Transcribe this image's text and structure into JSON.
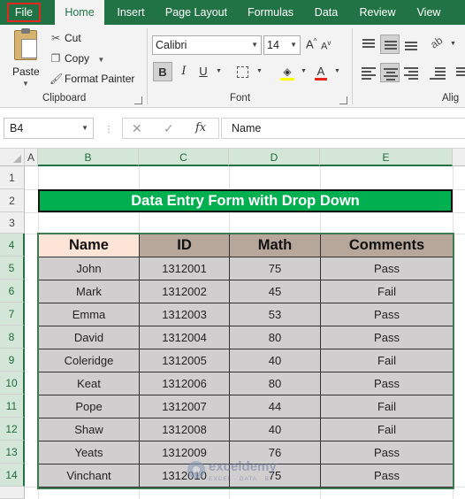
{
  "ribbon_tabs": [
    {
      "label": "File"
    },
    {
      "label": "Home"
    },
    {
      "label": "Insert"
    },
    {
      "label": "Page Layout"
    },
    {
      "label": "Formulas"
    },
    {
      "label": "Data"
    },
    {
      "label": "Review"
    },
    {
      "label": "View"
    }
  ],
  "active_tab": "Home",
  "clipboard": {
    "paste_label": "Paste",
    "cut_label": "Cut",
    "copy_label": "Copy",
    "format_painter_label": "Format Painter",
    "group_label": "Clipboard"
  },
  "font": {
    "name": "Calibri",
    "size": "14",
    "bold": "B",
    "italic": "I",
    "underline": "U",
    "grow": "A",
    "shrink": "A",
    "group_label": "Font"
  },
  "alignment": {
    "group_label": "Alig"
  },
  "formula_bar": {
    "name_box": "B4",
    "cancel": "✕",
    "enter": "✓",
    "fx": "fx",
    "content": "Name"
  },
  "columns": [
    "A",
    "B",
    "C",
    "D",
    "E"
  ],
  "selected_columns": [
    "B",
    "C",
    "D",
    "E"
  ],
  "rows": [
    "1",
    "2",
    "3",
    "4",
    "5",
    "6",
    "7",
    "8",
    "9",
    "10",
    "11",
    "12",
    "13",
    "14"
  ],
  "sheet": {
    "title": "Data Entry Form with Drop Down",
    "headers": [
      "Name",
      "ID",
      "Math",
      "Comments"
    ],
    "records": [
      [
        "John",
        "1312001",
        "75",
        "Pass"
      ],
      [
        "Mark",
        "1312002",
        "45",
        "Fail"
      ],
      [
        "Emma",
        "1312003",
        "53",
        "Pass"
      ],
      [
        "David",
        "1312004",
        "80",
        "Pass"
      ],
      [
        "Coleridge",
        "1312005",
        "40",
        "Fail"
      ],
      [
        "Keat",
        "1312006",
        "80",
        "Pass"
      ],
      [
        "Pope",
        "1312007",
        "44",
        "Fail"
      ],
      [
        "Shaw",
        "1312008",
        "40",
        "Fail"
      ],
      [
        "Yeats",
        "1312009",
        "76",
        "Pass"
      ],
      [
        "Vinchant",
        "1312010",
        "75",
        "Pass"
      ]
    ]
  },
  "watermark": {
    "brand": "exceldemy",
    "tagline": "EXCEL · DATA · BI"
  },
  "colors": {
    "ribbon_green": "#217346",
    "title_fill": "#00b050",
    "name_header_fill": "#fce4d6",
    "header_fill": "#b7a79b",
    "cell_fill": "#d0cece",
    "file_highlight": "#e0261f"
  }
}
